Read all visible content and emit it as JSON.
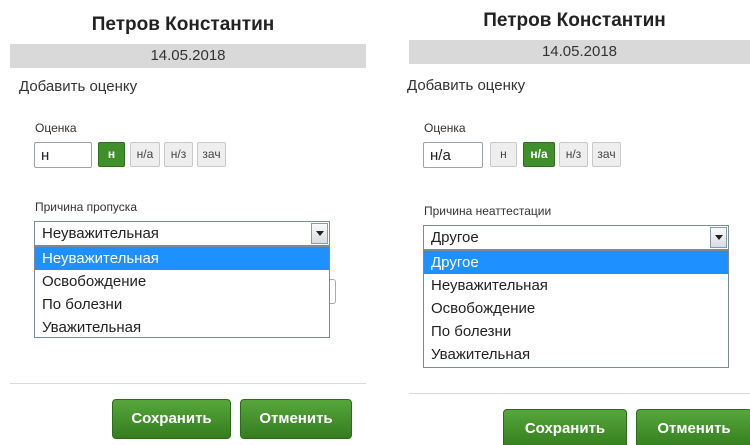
{
  "panels": [
    {
      "student_name": "Петров Константин",
      "date": "14.05.2018",
      "add_grade_title": "Добавить оценку",
      "grade_label": "Оценка",
      "grade_value": "н",
      "grade_buttons": [
        "н",
        "н/а",
        "н/з",
        "зач"
      ],
      "active_grade": "н",
      "reason_label": "Причина пропуска",
      "reason_selected": "Неуважительная",
      "reason_options": [
        "Неуважительная",
        "Освобождение",
        "По болезни",
        "Уважительная"
      ],
      "save_label": "Сохранить",
      "cancel_label": "Отменить"
    },
    {
      "student_name": "Петров Константин",
      "date": "14.05.2018",
      "add_grade_title": "Добавить оценку",
      "grade_label": "Оценка",
      "grade_value": "н/а",
      "grade_buttons": [
        "н",
        "н/а",
        "н/з",
        "зач"
      ],
      "active_grade": "н/а",
      "reason_label": "Причина неаттестации",
      "reason_selected": "Другое",
      "reason_options": [
        "Другое",
        "Неуважительная",
        "Освобождение",
        "По болезни",
        "Уважительная"
      ],
      "save_label": "Сохранить",
      "cancel_label": "Отменить"
    }
  ],
  "colors": {
    "accent_green": "#3f8f2a",
    "selected_option": "#1e90ff",
    "date_band": "#d9d9d9"
  }
}
